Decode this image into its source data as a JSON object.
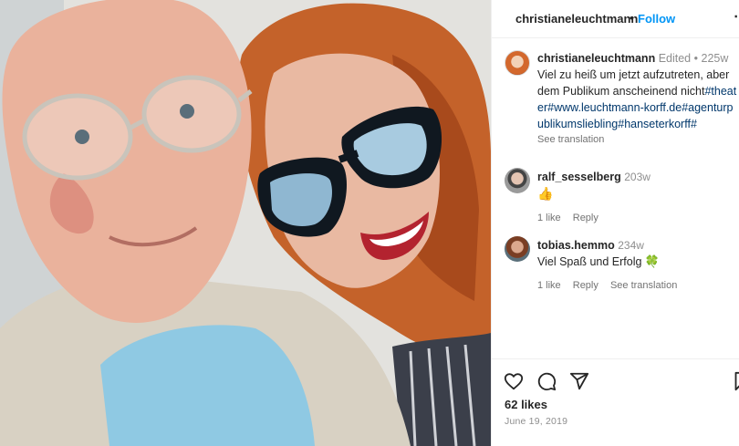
{
  "post": {
    "username": "christianeleuchtmann",
    "dot": "•",
    "follow_label": "Follow",
    "more_label": "⋯"
  },
  "caption": {
    "username": "christianeleuchtmann",
    "edited": "Edited",
    "time": "225w",
    "text_plain": "Viel zu heiß um jetzt aufzutreten, aber dem Publikum anscheinend nicht",
    "tag1": "#theater",
    "tag2": "#www.leuchtmann-korff.de",
    "tag3": "#agenturpublikumsliebling",
    "tag4": "#hanseterkorff",
    "tag5": "#",
    "see_translation": "See translation"
  },
  "comments": [
    {
      "username": "ralf_sesselberg",
      "time": "203w",
      "text": "👍",
      "likes": "1 like",
      "reply": "Reply"
    },
    {
      "username": "tobias.hemmo",
      "time": "234w",
      "text": "Viel Spaß und Erfolg",
      "emoji": "🍀",
      "likes": "1 like",
      "reply": "Reply",
      "see_translation": "See translation"
    }
  ],
  "footer": {
    "likes": "62 likes",
    "date": "June 19, 2019"
  },
  "icons": {
    "like": "heart-icon",
    "comment": "comment-icon",
    "share": "share-icon",
    "save": "bookmark-icon"
  },
  "colors": {
    "link": "#0095f6",
    "hashtag": "#00376b",
    "muted": "#8e8e8e"
  }
}
